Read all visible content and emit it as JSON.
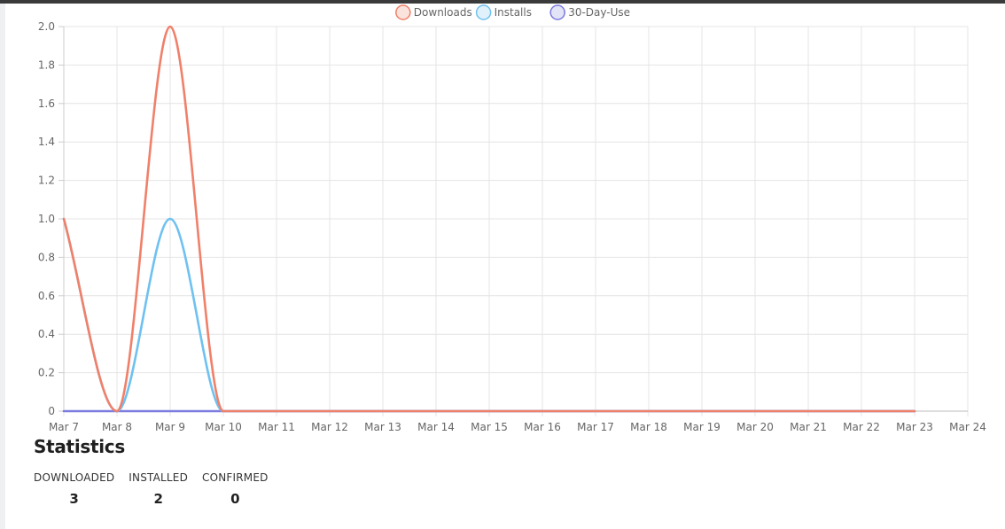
{
  "chart_data": {
    "type": "line",
    "categories": [
      "Mar 7",
      "Mar 8",
      "Mar 9",
      "Mar 10",
      "Mar 11",
      "Mar 12",
      "Mar 13",
      "Mar 14",
      "Mar 15",
      "Mar 16",
      "Mar 17",
      "Mar 18",
      "Mar 19",
      "Mar 20",
      "Mar 21",
      "Mar 22",
      "Mar 23",
      "Mar 24"
    ],
    "series": [
      {
        "name": "Downloads",
        "color": "#f0806a",
        "values": [
          1,
          0,
          2,
          0,
          0,
          0,
          0,
          0,
          0,
          0,
          0,
          0,
          0,
          0,
          0,
          0,
          0,
          null
        ]
      },
      {
        "name": "Installs",
        "color": "#6ec1f0",
        "values": [
          1,
          0,
          1,
          0,
          0,
          0,
          0,
          0,
          0,
          0,
          0,
          0,
          0,
          0,
          0,
          0,
          0,
          null
        ]
      },
      {
        "name": "30-Day-Use",
        "color": "#7b7be0",
        "values": [
          0,
          0,
          0,
          0,
          0,
          0,
          0,
          0,
          0,
          0,
          0,
          0,
          0,
          0,
          0,
          0,
          0,
          null
        ]
      }
    ],
    "ylim": [
      0,
      2.0
    ],
    "yticks": [
      "0",
      "0.2",
      "0.4",
      "0.6",
      "0.8",
      "1.0",
      "1.2",
      "1.4",
      "1.6",
      "1.8",
      "2.0"
    ],
    "grid": true,
    "legend_position": "top-center"
  },
  "statistics": {
    "title": "Statistics",
    "items": [
      {
        "label": "DOWNLOADED",
        "value": "3"
      },
      {
        "label": "INSTALLED",
        "value": "2"
      },
      {
        "label": "CONFIRMED",
        "value": "0"
      }
    ]
  }
}
